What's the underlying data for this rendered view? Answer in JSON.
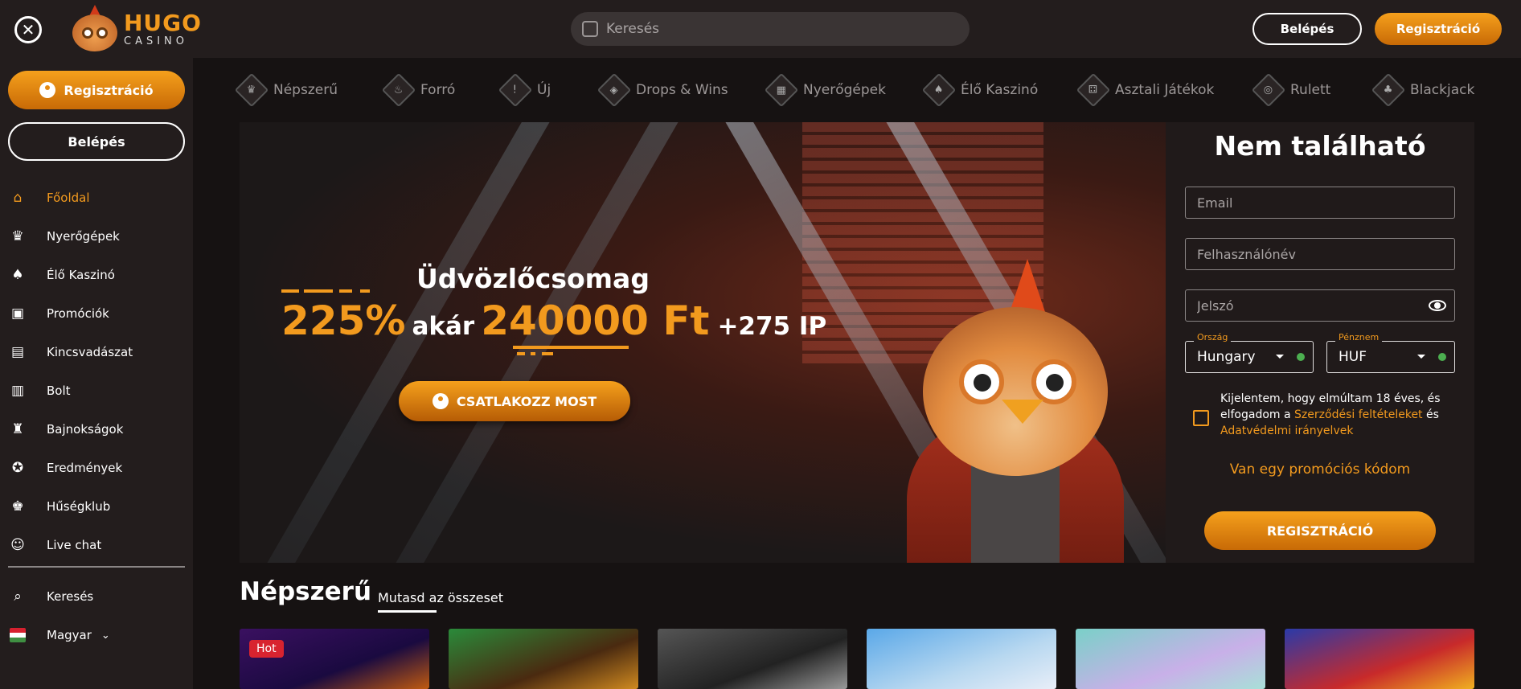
{
  "header": {
    "logo_line1": "HUGO",
    "logo_line2": "CASINO",
    "search_placeholder": "Keresés",
    "login_label": "Belépés",
    "register_label": "Regisztráció"
  },
  "sidebar": {
    "register_label": "Regisztráció",
    "login_label": "Belépés",
    "items": [
      {
        "label": "Főoldal",
        "icon": "home-icon",
        "active": true
      },
      {
        "label": "Nyerőgépek",
        "icon": "crown-icon",
        "active": false
      },
      {
        "label": "Élő Kaszinó",
        "icon": "cards-icon",
        "active": false
      },
      {
        "label": "Promóciók",
        "icon": "gift-icon",
        "active": false
      },
      {
        "label": "Kincsvadászat",
        "icon": "treasure-chest-icon",
        "active": false
      },
      {
        "label": "Bolt",
        "icon": "shop-icon",
        "active": false
      },
      {
        "label": "Bajnokságok",
        "icon": "trophy-icon",
        "active": false
      },
      {
        "label": "Eredmények",
        "icon": "medal-icon",
        "active": false
      },
      {
        "label": "Hűségklub",
        "icon": "crown-icon",
        "active": false
      },
      {
        "label": "Live chat",
        "icon": "chat-icon",
        "active": false
      }
    ],
    "search_label": "Keresés",
    "language_label": "Magyar"
  },
  "categories": [
    {
      "label": "Népszerű",
      "icon": "crown-icon"
    },
    {
      "label": "Forró",
      "icon": "flame-icon"
    },
    {
      "label": "Új",
      "icon": "exclamation-icon"
    },
    {
      "label": "Drops & Wins",
      "icon": "drops-wins-icon"
    },
    {
      "label": "Nyerőgépek",
      "icon": "slot-machine-icon"
    },
    {
      "label": "Élő Kaszinó",
      "icon": "live-casino-icon"
    },
    {
      "label": "Asztali Játékok",
      "icon": "dice-icon"
    },
    {
      "label": "Rulett",
      "icon": "roulette-icon"
    },
    {
      "label": "Blackjack",
      "icon": "blackjack-icon"
    }
  ],
  "hero": {
    "title": "Üdvözlőcsomag",
    "percent": "225%",
    "upto": "akár",
    "amount": "240000 Ft",
    "extra": "+275 IP",
    "cta_label": "CSATLAKOZZ MOST"
  },
  "register_form": {
    "title": "Nem található",
    "email_placeholder": "Email",
    "username_placeholder": "Felhasználónév",
    "password_placeholder": "Jelszó",
    "country_label": "Ország",
    "country_value": "Hungary",
    "currency_label": "Pénznem",
    "currency_value": "HUF",
    "terms_prefix": "Kijelentem, hogy elmúltam 18 éves, és elfogadom a ",
    "terms_link1": "Szerződési feltételeket",
    "terms_mid": " és ",
    "terms_link2": "Adatvédelmi irányelvek",
    "promo_label": "Van egy promóciós kódom",
    "submit_label": "REGISZTRÁCIÓ"
  },
  "popular": {
    "title": "Népszerű",
    "show_all": "Mutasd az összeset",
    "hot_badge": "Hot"
  },
  "colors": {
    "accent": "#f29a1e",
    "background": "#111010",
    "panel": "#231d1d"
  }
}
